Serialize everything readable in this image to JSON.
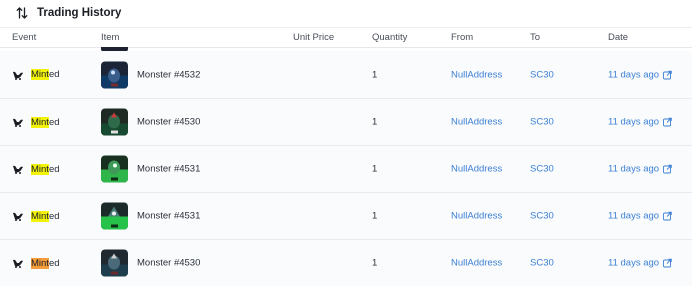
{
  "title": "Trading History",
  "columns": {
    "event": "Event",
    "item": "Item",
    "unit_price": "Unit Price",
    "quantity": "Quantity",
    "from": "From",
    "to": "To",
    "date": "Date"
  },
  "rows": [
    {
      "event_highlight": "Mint",
      "event_rest": "ed",
      "item": "Monster #4532",
      "quantity": "1",
      "from": "NullAddress",
      "to": "SC30",
      "date": "11 days ago"
    },
    {
      "event_highlight": "Mint",
      "event_rest": "ed",
      "item": "Monster #4530",
      "quantity": "1",
      "from": "NullAddress",
      "to": "SC30",
      "date": "11 days ago"
    },
    {
      "event_highlight": "Mint",
      "event_rest": "ed",
      "item": "Monster #4531",
      "quantity": "1",
      "from": "NullAddress",
      "to": "SC30",
      "date": "11 days ago"
    },
    {
      "event_highlight": "Mint",
      "event_rest": "ed",
      "item": "Monster #4531",
      "quantity": "1",
      "from": "NullAddress",
      "to": "SC30",
      "date": "11 days ago"
    },
    {
      "event_highlight": "Mint",
      "event_rest": "ed",
      "item": "Monster #4530",
      "quantity": "1",
      "from": "NullAddress",
      "to": "SC30",
      "date": "11 days ago"
    }
  ],
  "colors": {
    "link": "#3b7fd4",
    "highlight_yellow": "#f2f20a",
    "highlight_orange": "#f59d3a"
  },
  "icons": {
    "title": "sort-arrows-icon",
    "event": "mint-icon",
    "date": "external-link-icon"
  }
}
